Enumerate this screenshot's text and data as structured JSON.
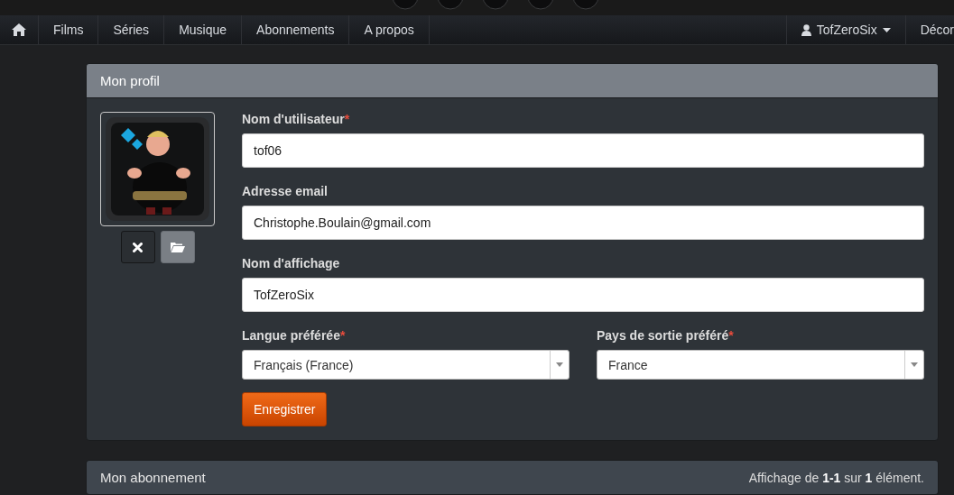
{
  "navbar": {
    "home": {
      "kind": "home"
    },
    "items": [
      {
        "label": "Films",
        "selected": false
      },
      {
        "label": "Séries",
        "selected": false
      },
      {
        "label": "Musique",
        "selected": false
      },
      {
        "label": "Abonnements",
        "selected": false
      },
      {
        "label": "A propos",
        "selected": false
      }
    ],
    "user": {
      "label": "TofZeroSix"
    },
    "logout": {
      "label": "Décor"
    }
  },
  "profile": {
    "title": "Mon profil",
    "fields": [
      {
        "label": "Nom d'utilisateur",
        "required_mark": "*",
        "value": "tof06"
      },
      {
        "label": "Adresse email",
        "value": "Christophe.Boulain@gmail.com"
      },
      {
        "label": "Nom d'affichage",
        "value": "TofZeroSix"
      }
    ],
    "selects": [
      {
        "label": "Langue préférée",
        "required_mark": "*",
        "value": "Français (France)"
      },
      {
        "label": "Pays de sortie préféré",
        "required_mark": "*",
        "value": "France"
      }
    ],
    "save_button": "Enregistrer"
  },
  "subscription": {
    "title": "Mon abonnement",
    "summary": "Affichage de **1-1** sur **1** élément."
  }
}
